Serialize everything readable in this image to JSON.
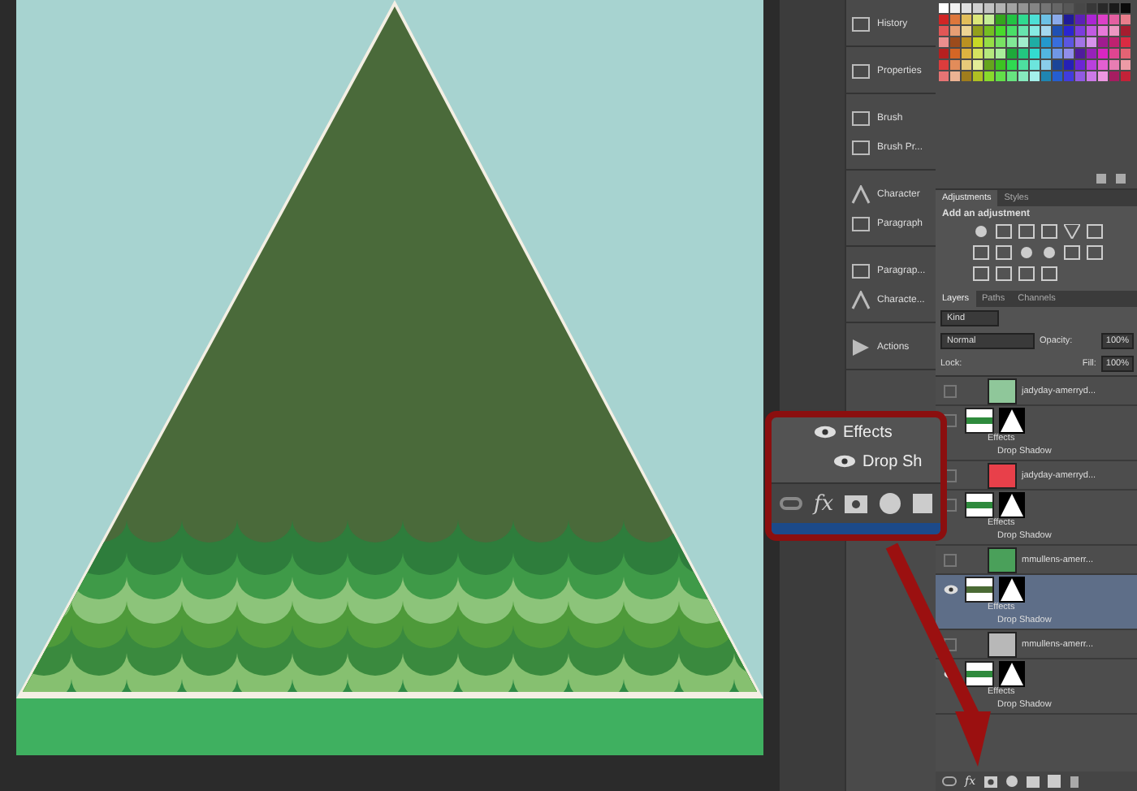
{
  "dock_groups": [
    [
      {
        "label": "History"
      }
    ],
    [
      {
        "label": "Properties"
      }
    ],
    [
      {
        "label": "Brush"
      },
      {
        "label": "Brush Pr..."
      }
    ],
    [
      {
        "label": "Character"
      },
      {
        "label": "Paragraph"
      }
    ],
    [
      {
        "label": "Paragrap..."
      },
      {
        "label": "Characte..."
      }
    ],
    [
      {
        "label": "Actions"
      }
    ]
  ],
  "adjustments_panel": {
    "tabs": [
      {
        "label": "Adjustments",
        "selected": true
      },
      {
        "label": "Styles",
        "selected": false
      }
    ],
    "heading": "Add an adjustment"
  },
  "layers_panel": {
    "tabs": [
      {
        "label": "Layers",
        "selected": true
      },
      {
        "label": "Paths",
        "selected": false
      },
      {
        "label": "Channels",
        "selected": false
      }
    ],
    "filter": "Kind",
    "blend_mode": "Normal",
    "opacity_label": "Opacity:",
    "opacity": "100%",
    "lock_label": "Lock:",
    "fill_label": "Fill:",
    "fill": "100%",
    "layers": [
      {
        "kind": "clipped",
        "name": "jadyday-amerryd...",
        "color": "#8fc79a",
        "visible": false,
        "selected": false
      },
      {
        "kind": "masked",
        "color": "#2e8a3c",
        "visible": false,
        "selected": false,
        "effects_label": "Effects",
        "effect": "Drop Shadow"
      },
      {
        "kind": "clipped",
        "name": "jadyday-amerryd...",
        "color": "#e8404a",
        "visible": false,
        "selected": false
      },
      {
        "kind": "masked",
        "color": "#2e8a3c",
        "visible": false,
        "selected": false,
        "effects_label": "Effects",
        "effect": "Drop Shadow"
      },
      {
        "kind": "clipped",
        "name": "mmullens-amerr...",
        "color": "#4aa05a",
        "visible": false,
        "selected": false
      },
      {
        "kind": "masked",
        "color": "#4a6a34",
        "visible": true,
        "selected": true,
        "effects_label": "Effects",
        "effect": "Drop Shadow"
      },
      {
        "kind": "clipped",
        "name": "mmullens-amerr...",
        "color": "#b8b8b8",
        "visible": false,
        "selected": false
      },
      {
        "kind": "masked",
        "color": "#2e8a3c",
        "visible": true,
        "selected": false,
        "effects_label": "Effects",
        "effect": "Drop Shadow"
      }
    ],
    "toolbar_fx": "fx"
  },
  "callout": {
    "effects_label": "Effects",
    "effect": "Drop Sh",
    "fx": "fx"
  }
}
